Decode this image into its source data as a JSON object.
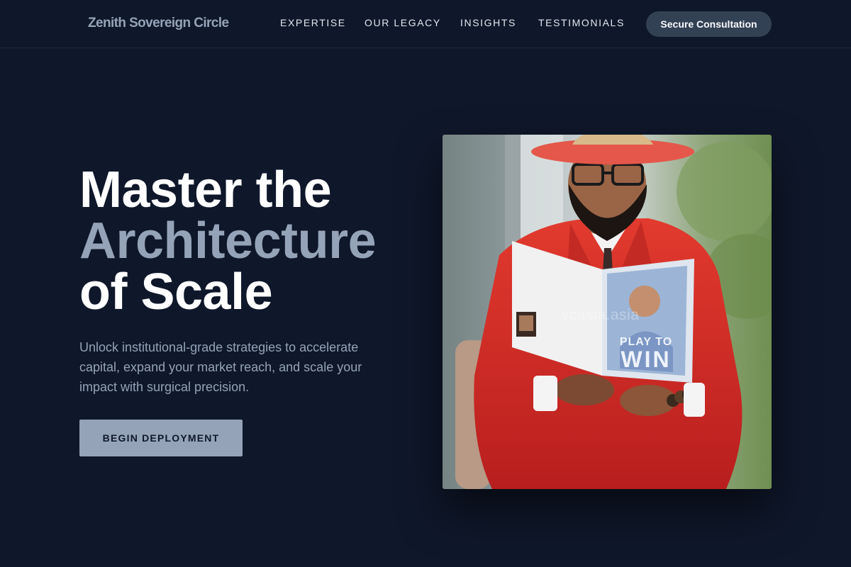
{
  "brand": {
    "name": "Zenith Sovereign Circle"
  },
  "nav": {
    "items": [
      {
        "label": "EXPERTISE"
      },
      {
        "label": "OUR LEGACY"
      },
      {
        "label": "INSIGHTS"
      },
      {
        "label": "TESTIMONIALS"
      }
    ],
    "cta_label": "Secure Consultation"
  },
  "hero": {
    "headline_line1": "Master the",
    "headline_line2": "Architecture",
    "headline_line3": "of Scale",
    "subtext": "Unlock institutional-grade strategies to accelerate capital, expand your market reach, and scale your impact with surgical precision.",
    "cta_label": "BEGIN DEPLOYMENT",
    "image": {
      "subject": "man in red blazer and wide-brim hat reading a book",
      "book_title_line1": "PLAY TO",
      "book_title_line2": "WIN",
      "watermark": "vcasia.asia"
    }
  },
  "colors": {
    "background": "#0f172a",
    "accent_muted": "#94a3b8",
    "button_dark": "#334155",
    "blazer_red": "#d62828"
  }
}
